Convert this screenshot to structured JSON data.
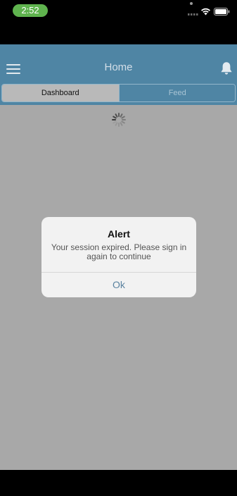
{
  "status_bar": {
    "time": "2:52",
    "time_pill_color": "#5fb34e"
  },
  "nav": {
    "title": "Home",
    "background": "#4f85a4",
    "menu_icon": "hamburger-menu-icon",
    "bell_icon": "bell-icon"
  },
  "tabs": [
    {
      "label": "Dashboard",
      "selected": true
    },
    {
      "label": "Feed",
      "selected": false
    }
  ],
  "content": {
    "loading": true,
    "background": "#a8a8a8"
  },
  "alert": {
    "title": "Alert",
    "message": "Your session expired. Please sign in again to continue",
    "button_label": "Ok",
    "button_color": "#5b83a0"
  }
}
